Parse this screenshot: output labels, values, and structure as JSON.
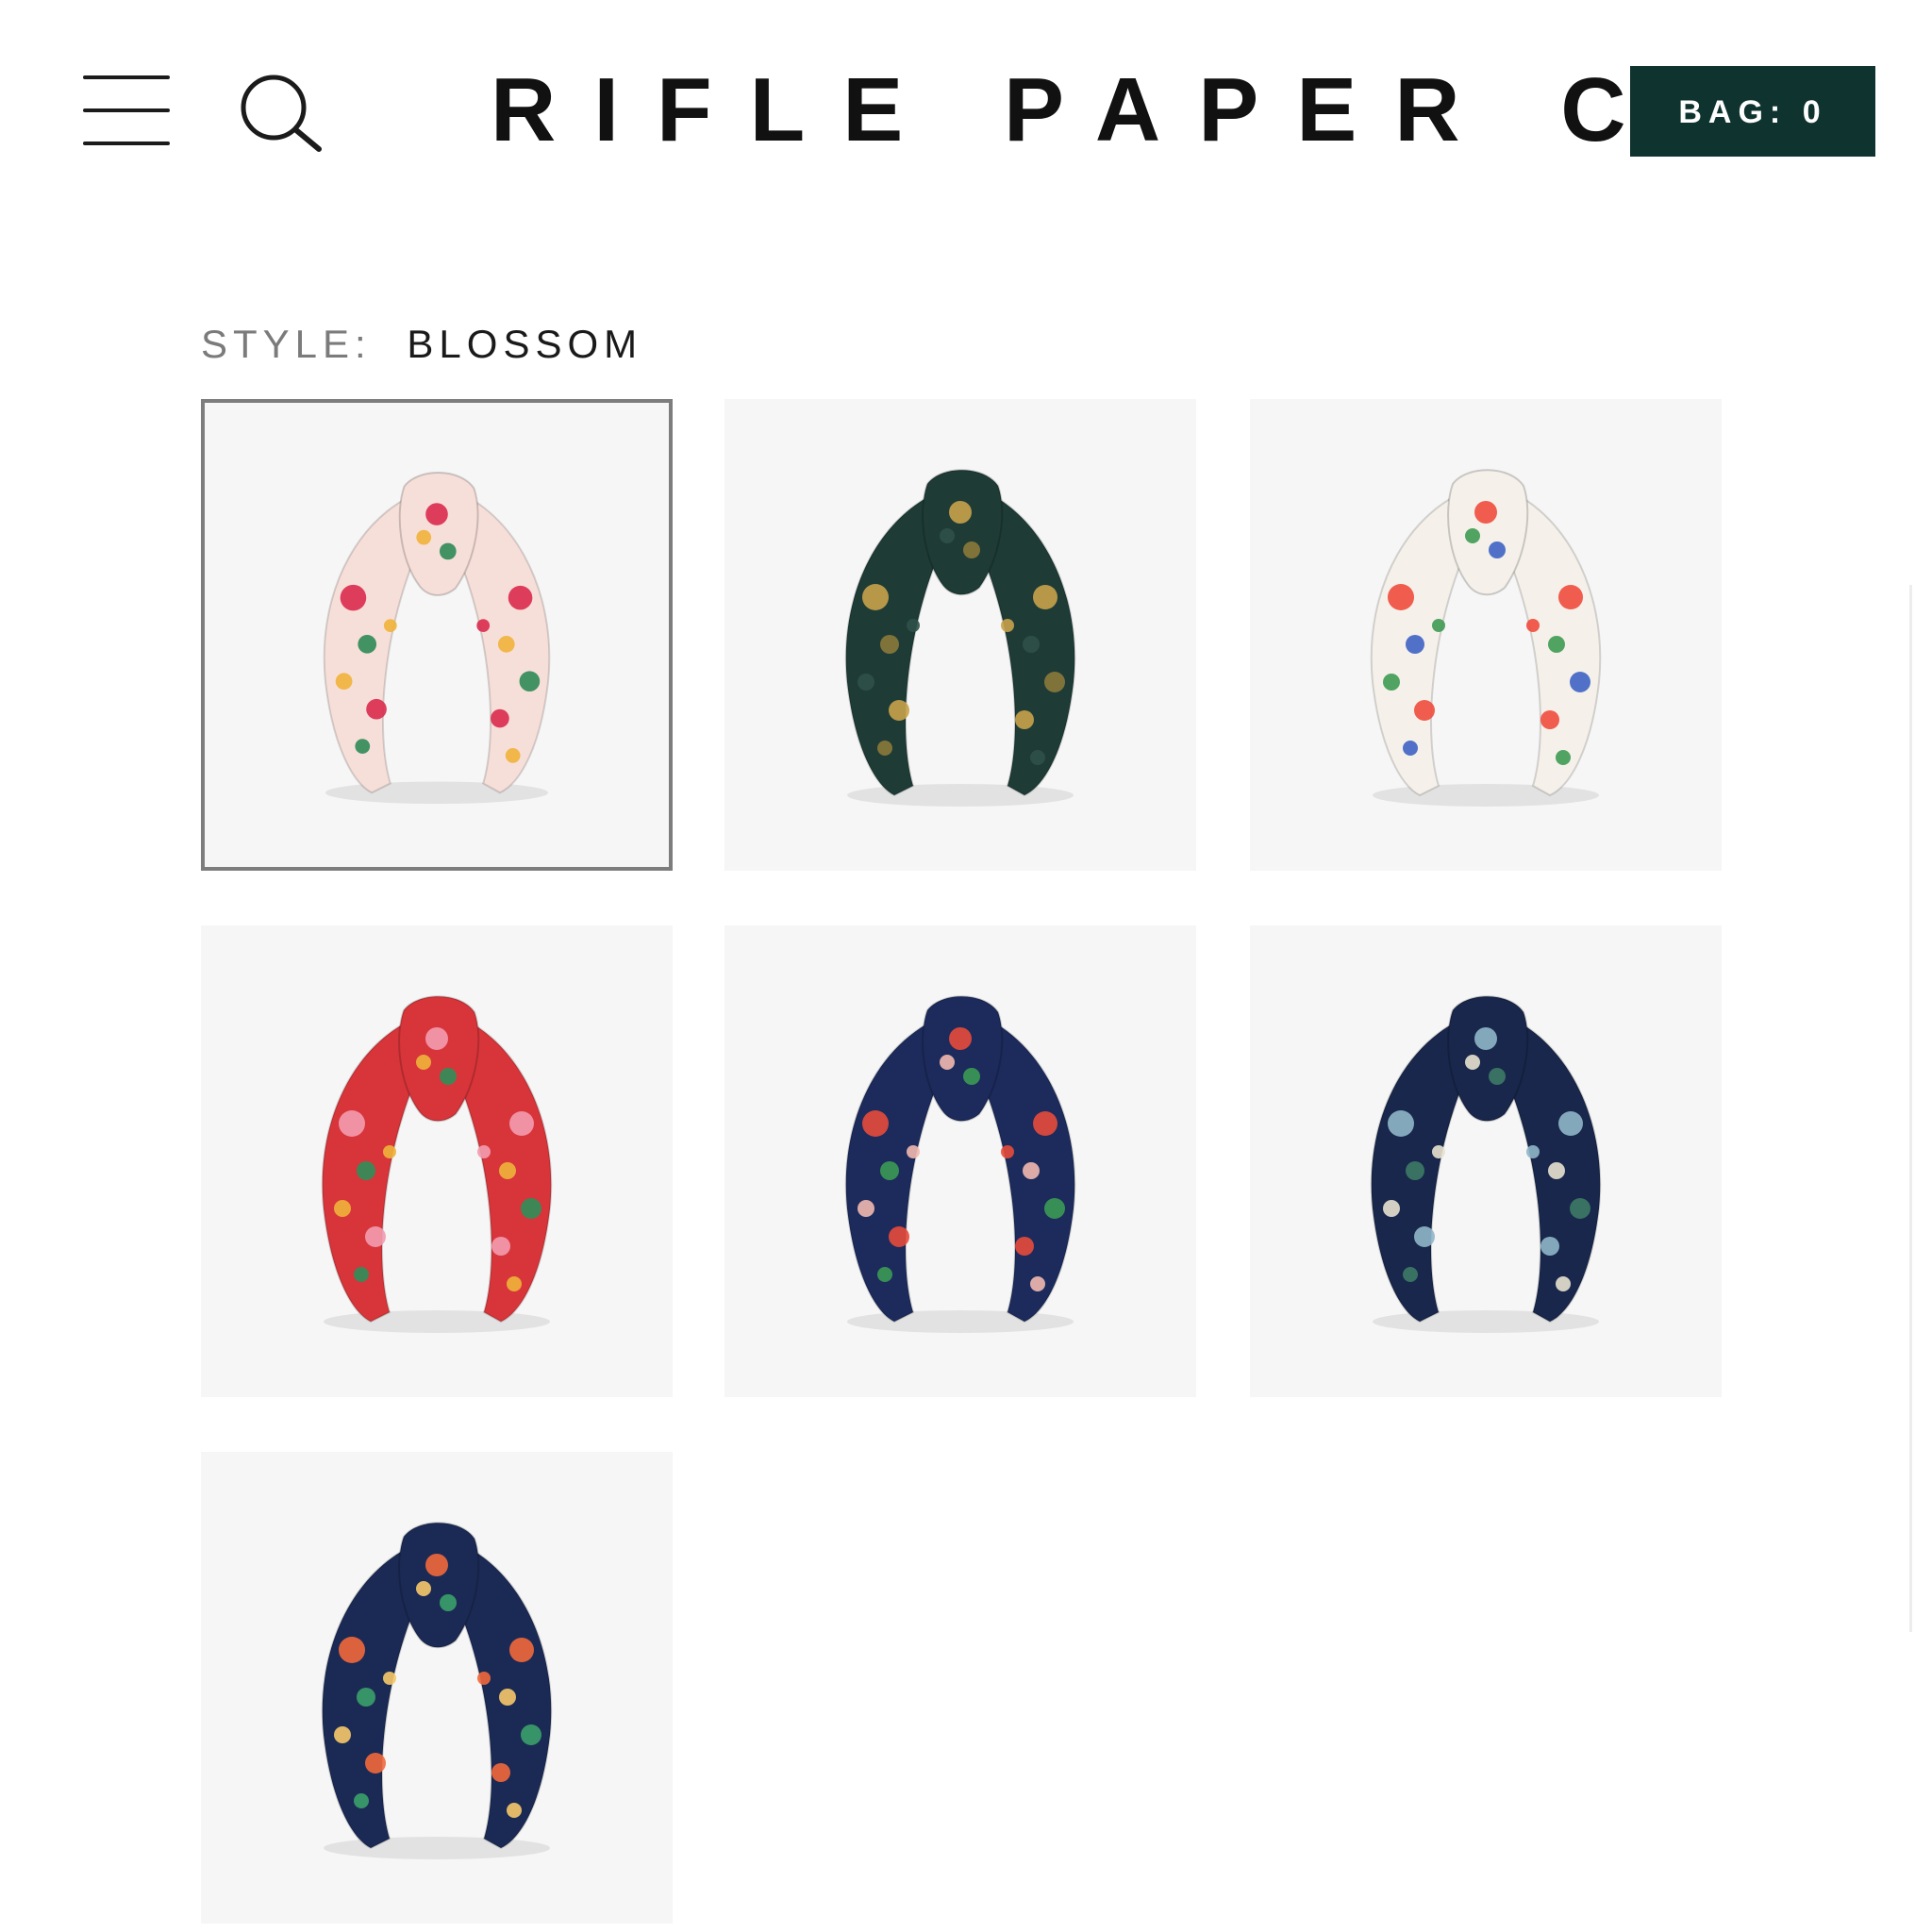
{
  "header": {
    "menu_icon": "hamburger-menu-icon",
    "search_icon": "search-icon",
    "logo_text": "RIFLE PAPER CO.",
    "bag_label": "BAG: 0"
  },
  "style_selector": {
    "label": "STYLE:",
    "selected_value": "BLOSSOM",
    "swatches": [
      {
        "selected": true,
        "colors": {
          "base": "#f7dfd9",
          "accent1": "#d92b4d",
          "accent2": "#2e8a55",
          "accent3": "#f0b23b"
        }
      },
      {
        "selected": false,
        "colors": {
          "base": "#1e3b36",
          "accent1": "#c8a24a",
          "accent2": "#8a7a3a",
          "accent3": "#2f5148"
        }
      },
      {
        "selected": false,
        "colors": {
          "base": "#f5f1ea",
          "accent1": "#ef4b3c",
          "accent2": "#3f63c4",
          "accent3": "#3f9a53"
        }
      },
      {
        "selected": false,
        "colors": {
          "base": "#d7353a",
          "accent1": "#f39bb0",
          "accent2": "#2f8f5a",
          "accent3": "#f0b23b"
        }
      },
      {
        "selected": false,
        "colors": {
          "base": "#1c2b5c",
          "accent1": "#e74a3b",
          "accent2": "#3c9a54",
          "accent3": "#f2b9b0"
        }
      },
      {
        "selected": false,
        "colors": {
          "base": "#18274b",
          "accent1": "#8fb7c9",
          "accent2": "#3d7a66",
          "accent3": "#e8e2d0"
        }
      },
      {
        "selected": false,
        "colors": {
          "base": "#1b2a55",
          "accent1": "#f2683c",
          "accent2": "#3ba06a",
          "accent3": "#f6c86a"
        }
      }
    ]
  }
}
